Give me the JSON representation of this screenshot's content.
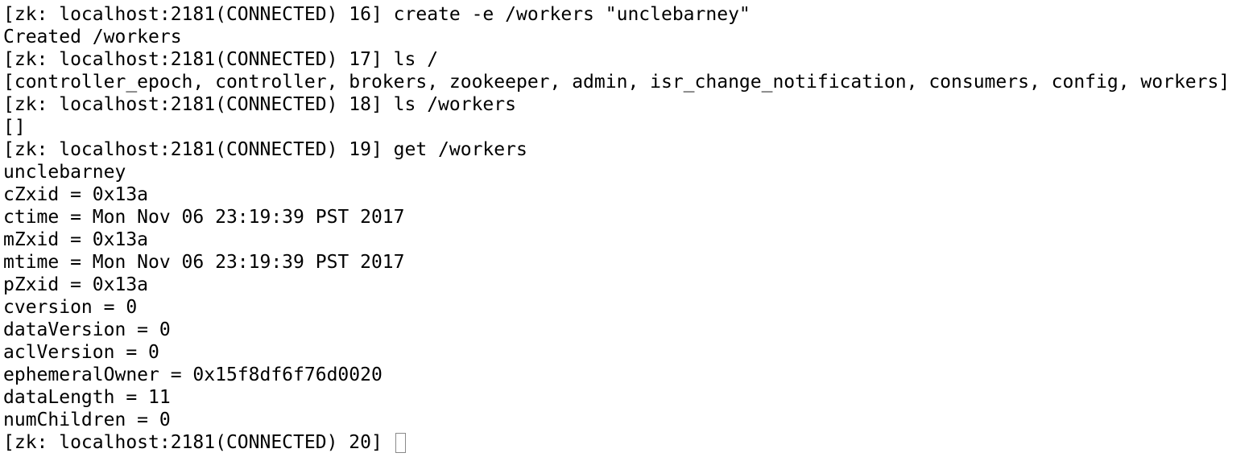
{
  "terminal": {
    "lines": [
      "[zk: localhost:2181(CONNECTED) 16] create -e /workers \"unclebarney\"",
      "Created /workers",
      "[zk: localhost:2181(CONNECTED) 17] ls /",
      "[controller_epoch, controller, brokers, zookeeper, admin, isr_change_notification, consumers, config, workers]",
      "[zk: localhost:2181(CONNECTED) 18] ls /workers",
      "[]",
      "[zk: localhost:2181(CONNECTED) 19] get /workers",
      "unclebarney",
      "cZxid = 0x13a",
      "ctime = Mon Nov 06 23:19:39 PST 2017",
      "mZxid = 0x13a",
      "mtime = Mon Nov 06 23:19:39 PST 2017",
      "pZxid = 0x13a",
      "cversion = 0",
      "dataVersion = 0",
      "aclVersion = 0",
      "ephemeralOwner = 0x15f8df6f76d0020",
      "dataLength = 11",
      "numChildren = 0"
    ],
    "prompt": "[zk: localhost:2181(CONNECTED) 20] "
  }
}
